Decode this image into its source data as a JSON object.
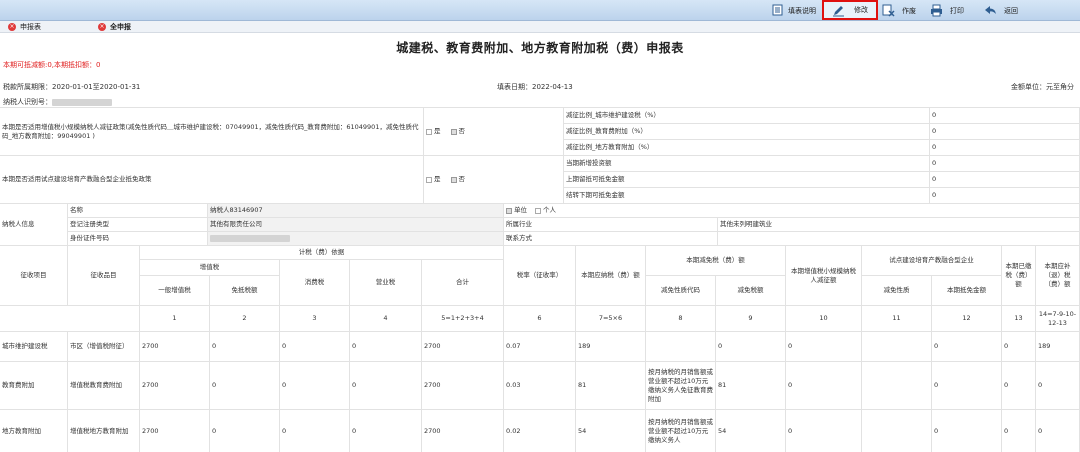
{
  "toolbar": {
    "buttons": [
      {
        "label": "填表说明",
        "icon": "document-icon"
      },
      {
        "label": "修改",
        "icon": "pencil-icon"
      },
      {
        "label": "作废",
        "icon": "void-icon"
      },
      {
        "label": "打印",
        "icon": "printer-icon"
      },
      {
        "label": "返回",
        "icon": "back-arrow-icon"
      }
    ]
  },
  "tabs": [
    {
      "label": "申报表"
    },
    {
      "label": "全申报"
    }
  ],
  "page_title": "城建税、教育费附加、地方教育附加税（费）申报表",
  "warning": "本期可抵减额:0,本期抵扣额：0",
  "header": {
    "period": "税款所属期限：2020-01-01至2020-01-31",
    "fill_date": "填表日期：2022-04-13",
    "unit": "金额单位：元至角分",
    "taxpayer_id_label": "纳税人识别号："
  },
  "policy1": {
    "question": "本期是否适用增值税小规模纳税人减征政策(减免性质代码＿城市维护建设税：07049901，减免性质代码_教育费附加：61049901，减免性质代码_地方教育附加：99049901 )",
    "yes": "是",
    "no": "否",
    "rows": [
      {
        "label": "减征比例_城市维护建设税（%）",
        "value": "0"
      },
      {
        "label": "减征比例_教育费附加（%）",
        "value": "0"
      },
      {
        "label": "减征比例_地方教育附加（%）",
        "value": "0"
      }
    ]
  },
  "policy2": {
    "question": "本期是否适用试点建设培育产教融合型企业抵免政策",
    "yes": "是",
    "no": "否",
    "rows": [
      {
        "label": "当期新增投资额",
        "value": "0"
      },
      {
        "label": "上期留抵可抵免金额",
        "value": "0"
      },
      {
        "label": "结转下期可抵免金额",
        "value": "0"
      }
    ]
  },
  "taxpayer": {
    "section_label": "纳税人信息",
    "name_label": "名称",
    "name_value": "纳税人83146907",
    "unit_option": "单位",
    "person_option": "个人",
    "reg_type_label": "登记注册类型",
    "reg_type_value": "其他有限责任公司",
    "industry_label": "所属行业",
    "industry_value": "其他未列明建筑业",
    "id_type_label": "身份证件号码",
    "contact_label": "联系方式"
  },
  "table": {
    "headers": {
      "item": "征收项目",
      "subitem": "征收品目",
      "basis": "计税（费）依据",
      "vat": "增值税",
      "vat_general": "一般增值税",
      "vat_exempt": "免抵税额",
      "consumption": "消费税",
      "business": "营业税",
      "total": "合计",
      "rate": "税率（征收率）",
      "payable": "本期应纳税（费）额",
      "relief": "本期减免税（费）额",
      "relief_code": "减免性质代码",
      "relief_amount": "减免税额",
      "small_scale": "本期增值税小规模纳税人减征额",
      "pilot": "试点建设培育产教融合型企业",
      "pilot_code": "减免性质",
      "pilot_amount": "本期抵免金额",
      "paid": "本期已缴税（费）额",
      "refund": "本期应补（退）税（费）额"
    },
    "col_numbers": [
      "1",
      "2",
      "3",
      "4",
      "5=1+2+3+4",
      "6",
      "7=5×6",
      "8",
      "9",
      "10",
      "11",
      "12",
      "13",
      "14=7-9-10-12-13"
    ],
    "rows": [
      {
        "item": "城市维护建设税",
        "subitem": "市区（增值税附征）",
        "c1": "2700",
        "c2": "0",
        "c3": "0",
        "c4": "0",
        "c5": "2700",
        "c6": "0.07",
        "c7": "189",
        "c8": "",
        "c9": "0",
        "c10": "0",
        "c11": "",
        "c12": "0",
        "c13": "0",
        "c14": "189"
      },
      {
        "item": "教育费附加",
        "subitem": "增值税教育费附加",
        "c1": "2700",
        "c2": "0",
        "c3": "0",
        "c4": "0",
        "c5": "2700",
        "c6": "0.03",
        "c7": "81",
        "c8": "按月纳税的月销售额或营业额不超过10万元缴纳义务人免征教育费附加",
        "c9": "81",
        "c10": "0",
        "c11": "",
        "c12": "0",
        "c13": "0",
        "c14": "0"
      },
      {
        "item": "地方教育附加",
        "subitem": "增值税地方教育附加",
        "c1": "2700",
        "c2": "0",
        "c3": "0",
        "c4": "0",
        "c5": "2700",
        "c6": "0.02",
        "c7": "54",
        "c8": "按月纳税的月销售额或营业额不超过10万元缴纳义务人",
        "c9": "54",
        "c10": "0",
        "c11": "",
        "c12": "0",
        "c13": "0",
        "c14": "0"
      }
    ]
  },
  "colors": {
    "toolbar_bg": "#c8dcf0",
    "highlight": "#e01010",
    "warning": "#e02020"
  }
}
